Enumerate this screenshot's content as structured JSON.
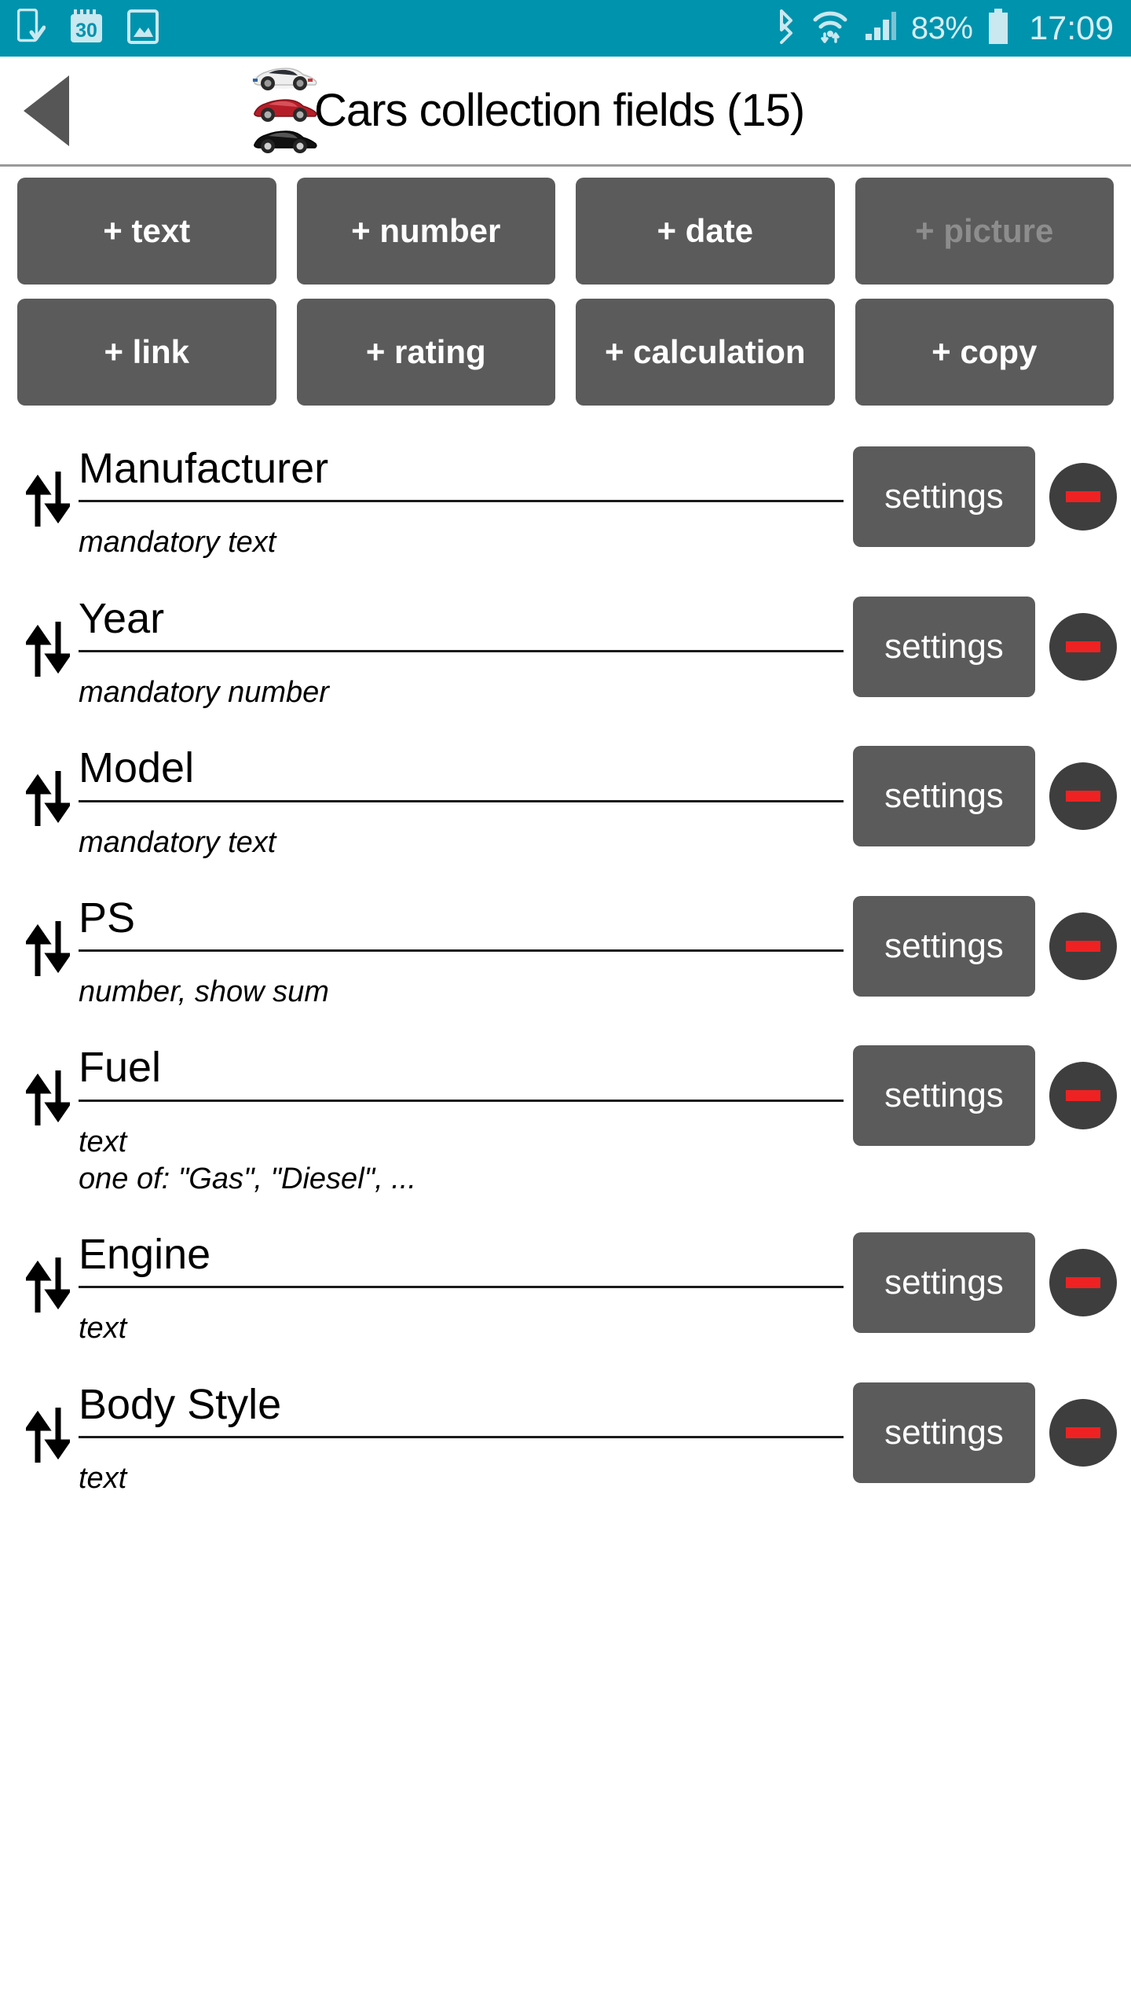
{
  "statusbar": {
    "background": "#0093ae",
    "foreground": "#d6eef3",
    "left_icons": [
      {
        "name": "phone-download-icon"
      },
      {
        "name": "calendar-icon",
        "label": "30"
      },
      {
        "name": "gallery-picture-icon"
      }
    ],
    "right_icons": [
      {
        "name": "bluetooth-icon"
      },
      {
        "name": "wifi-icon"
      },
      {
        "name": "cellular-signal-icon"
      }
    ],
    "battery_percent": "83%",
    "clock": "17:09"
  },
  "titlebar": {
    "back_label": "back",
    "logo_name": "cars-collection-icon",
    "title": "Cars collection fields (15)"
  },
  "add_buttons": {
    "row1": [
      {
        "label": "+ text",
        "disabled": false
      },
      {
        "label": "+ number",
        "disabled": false
      },
      {
        "label": "+ date",
        "disabled": false
      },
      {
        "label": "+ picture",
        "disabled": true
      }
    ],
    "row2": [
      {
        "label": "+ link",
        "disabled": false
      },
      {
        "label": "+ rating",
        "disabled": false
      },
      {
        "label": "+ calculation",
        "disabled": false
      },
      {
        "label": "+ copy",
        "disabled": false
      }
    ]
  },
  "row_actions": {
    "settings_label": "settings",
    "remove_label": "remove",
    "settings_color": "#5b5b5b",
    "remove_circle_color": "#3e3e3e",
    "remove_bar_color": "#ee2222"
  },
  "fields": [
    {
      "name": "Manufacturer",
      "description": "mandatory text"
    },
    {
      "name": "Year",
      "description": "mandatory number"
    },
    {
      "name": "Model",
      "description": "mandatory text"
    },
    {
      "name": "PS",
      "description": "number, show sum"
    },
    {
      "name": "Fuel",
      "description": "text\none of: \"Gas\", \"Diesel\", ..."
    },
    {
      "name": "Engine",
      "description": "text"
    },
    {
      "name": "Body Style",
      "description": "text"
    }
  ]
}
